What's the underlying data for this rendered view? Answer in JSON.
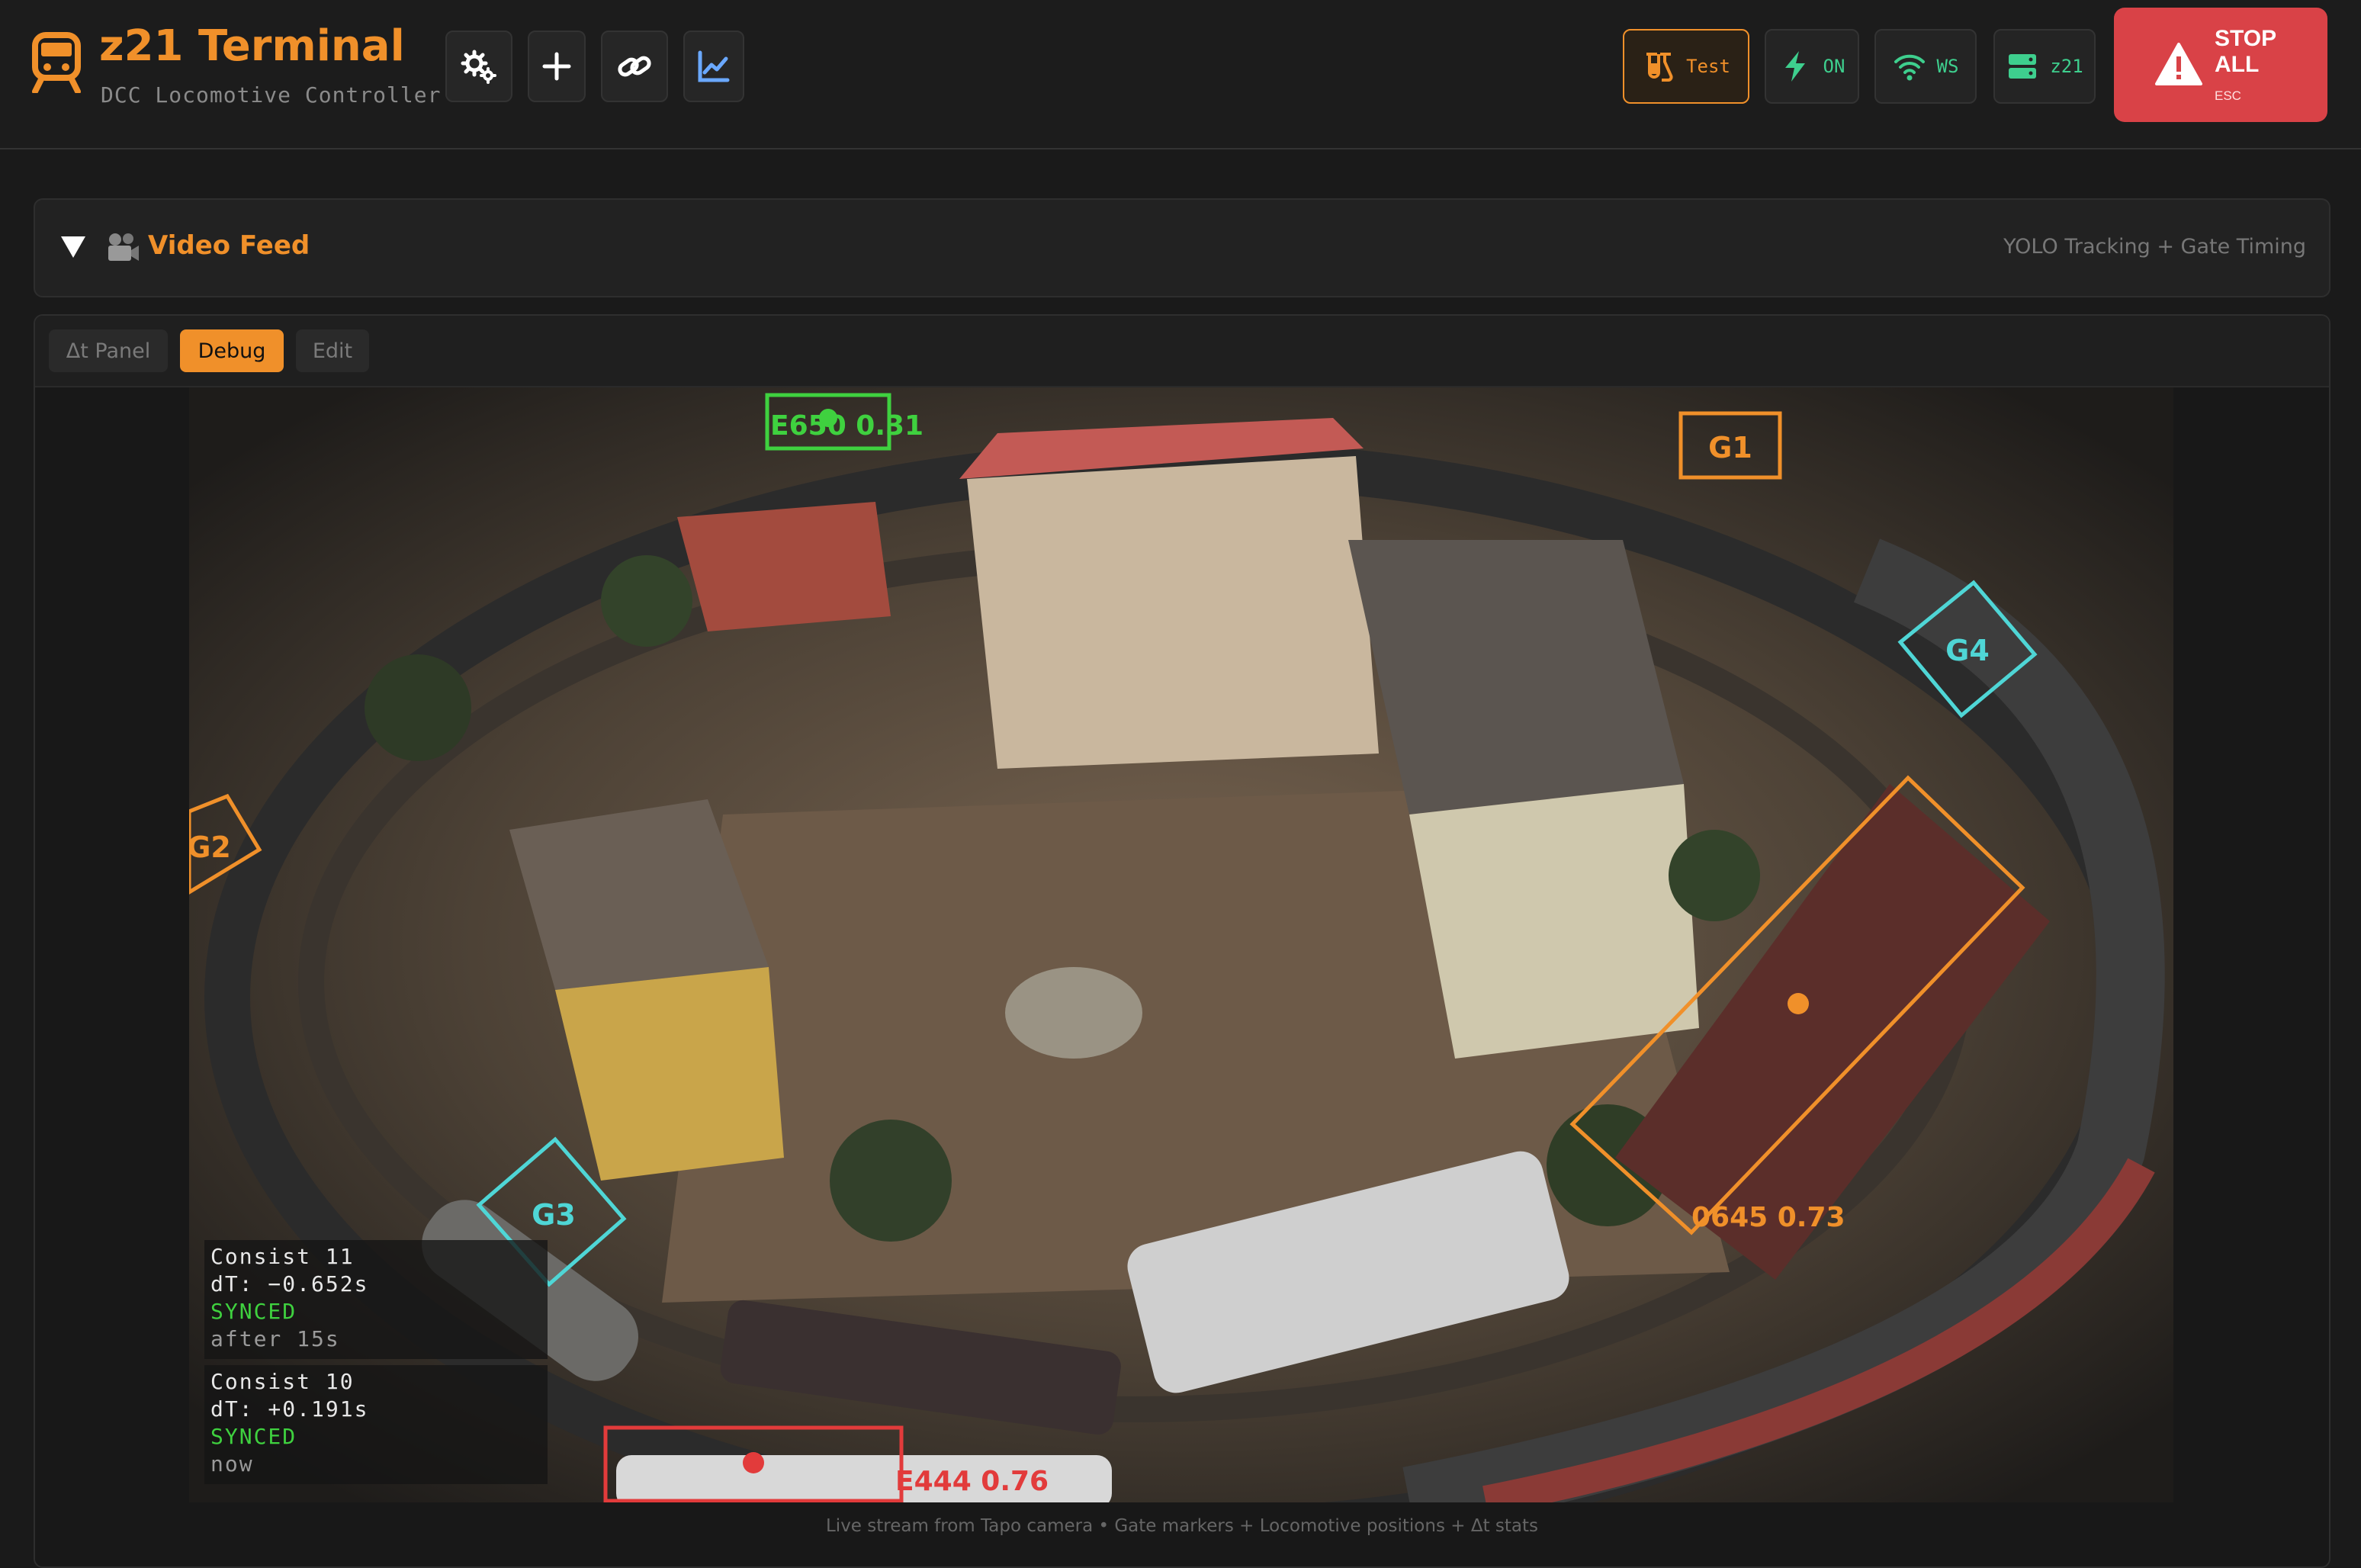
{
  "header": {
    "title": "z21 Terminal",
    "subtitle": "DCC Locomotive Controller",
    "toolbar": [
      {
        "name": "settings-button",
        "icon": "gears-icon"
      },
      {
        "name": "add-button",
        "icon": "plus-icon"
      },
      {
        "name": "link-button",
        "icon": "link-icon"
      },
      {
        "name": "chart-button",
        "icon": "line-chart-icon"
      }
    ],
    "status": {
      "test": {
        "label": "Test",
        "icon": "flask-icon",
        "color": "#f0902a"
      },
      "power": {
        "label": "ON",
        "icon": "lightning-icon",
        "color": "#3ecf8e"
      },
      "ws": {
        "label": "WS",
        "icon": "wifi-icon",
        "color": "#3ecf8e"
      },
      "z21": {
        "label": "z21",
        "icon": "server-icon",
        "color": "#3ecf8e"
      }
    },
    "stop": {
      "line1": "STOP",
      "line2": "ALL",
      "shortcut": "ESC",
      "icon": "warning-icon",
      "color": "#d94247"
    }
  },
  "section": {
    "title": "Video Feed",
    "icon": "camera-icon",
    "right_text": "YOLO Tracking + Gate Timing"
  },
  "tabs": [
    {
      "label": "Δt Panel",
      "active": false
    },
    {
      "label": "Debug",
      "active": true
    },
    {
      "label": "Edit",
      "active": false
    }
  ],
  "video": {
    "gates": [
      {
        "label": "G1",
        "color": "#f0902a"
      },
      {
        "label": "G2",
        "color": "#f0902a"
      },
      {
        "label": "G3",
        "color": "#4fd6d6"
      },
      {
        "label": "G4",
        "color": "#4fd6d6"
      }
    ],
    "detections": [
      {
        "label": "E650 0.31",
        "color": "#3fd13f"
      },
      {
        "label": "0645 0.73",
        "color": "#f0902a"
      },
      {
        "label": "E444 0.76",
        "color": "#e23b3b"
      }
    ],
    "stats": [
      {
        "consist": "Consist 11",
        "dt": "dT: −0.652s",
        "state": "SYNCED",
        "when": "after 15s"
      },
      {
        "consist": "Consist 10",
        "dt": "dT: +0.191s",
        "state": "SYNCED",
        "when": "now"
      }
    ]
  },
  "caption": "Live stream from Tapo camera • Gate markers + Locomotive positions + Δt stats"
}
